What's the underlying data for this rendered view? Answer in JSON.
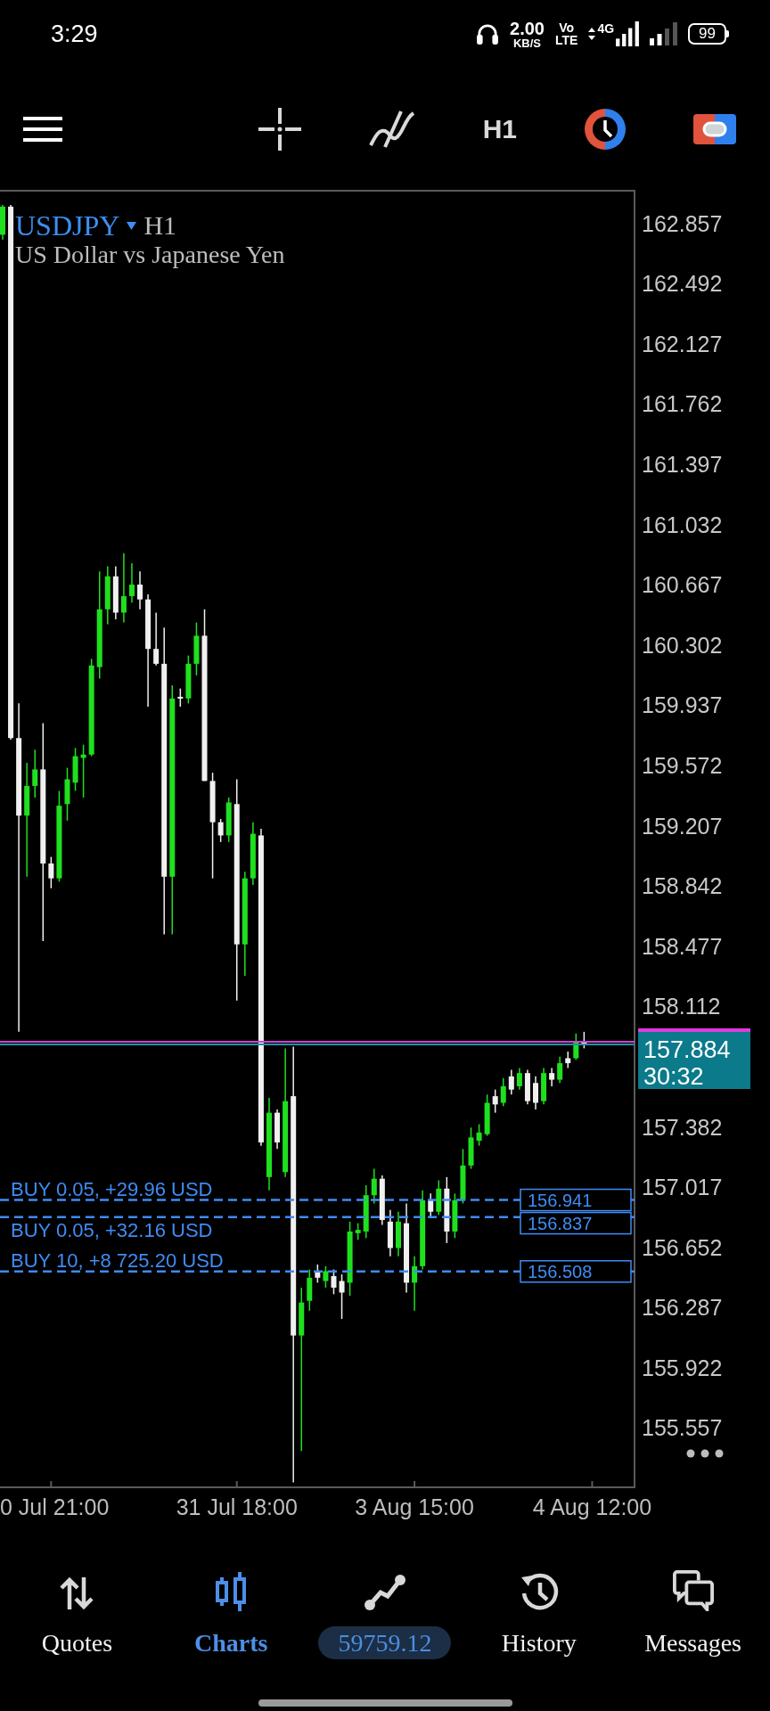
{
  "status_bar": {
    "time": "3:29",
    "speed": "2.00",
    "speed_unit": "KB/S",
    "volte_top": "Vo",
    "volte_bottom": "LTE",
    "network": "4G",
    "battery": "99"
  },
  "toolbar": {
    "timeframe": "H1"
  },
  "chart": {
    "symbol": "USDJPY",
    "period": "H1",
    "description": "US Dollar vs Japanese Yen",
    "current_price": "157.884",
    "bar_countdown": "30:32",
    "orders": [
      {
        "label": "BUY 0.05, +29.96 USD",
        "price": "156.941"
      },
      {
        "label": "BUY 0.05, +32.16 USD",
        "price": "156.837"
      },
      {
        "label": "BUY 10, +8 725.20 USD",
        "price": "156.508"
      }
    ],
    "chart_data": {
      "type": "candlestick",
      "categories": [
        null,
        null,
        null,
        null,
        null,
        null,
        "0 Jul 21:00",
        null,
        null,
        null,
        null,
        null,
        null,
        null,
        null,
        null,
        null,
        null,
        null,
        null,
        null,
        null,
        null,
        null,
        null,
        null,
        null,
        null,
        null,
        "31 Jul 18:00",
        null,
        null,
        null,
        null,
        null,
        null,
        null,
        null,
        null,
        null,
        null,
        null,
        null,
        null,
        null,
        null,
        null,
        null,
        null,
        null,
        null,
        "3 Aug 15:00",
        null,
        null,
        null,
        null,
        null,
        null,
        null,
        null,
        null,
        null,
        null,
        null,
        null,
        null,
        null,
        null,
        null,
        null,
        null,
        null,
        null,
        "4 Aug 12:00"
      ],
      "ohlc": [
        [
          162.79,
          162.97,
          162.76,
          162.96
        ],
        [
          162.96,
          162.97,
          159.73,
          159.74
        ],
        [
          159.74,
          159.95,
          157.96,
          159.27
        ],
        [
          159.27,
          159.59,
          158.9,
          159.45
        ],
        [
          159.45,
          159.67,
          159.38,
          159.55
        ],
        [
          159.55,
          159.83,
          158.51,
          158.98
        ],
        [
          158.98,
          159.02,
          158.83,
          158.89
        ],
        [
          158.89,
          159.42,
          158.87,
          159.33
        ],
        [
          159.34,
          159.56,
          159.24,
          159.49
        ],
        [
          159.47,
          159.68,
          159.42,
          159.63
        ],
        [
          159.62,
          159.7,
          159.38,
          159.64
        ],
        [
          159.64,
          160.22,
          159.63,
          160.18
        ],
        [
          160.17,
          160.75,
          160.1,
          160.52
        ],
        [
          160.52,
          160.78,
          160.43,
          160.72
        ],
        [
          160.72,
          160.78,
          160.46,
          160.5
        ],
        [
          160.5,
          160.86,
          160.44,
          160.6
        ],
        [
          160.6,
          160.8,
          160.56,
          160.67
        ],
        [
          160.67,
          160.75,
          160.52,
          160.58
        ],
        [
          160.58,
          160.61,
          159.93,
          160.28
        ],
        [
          160.28,
          160.5,
          160.18,
          160.19
        ],
        [
          160.19,
          160.41,
          158.55,
          158.9
        ],
        [
          158.9,
          160.06,
          158.55,
          159.98
        ],
        [
          159.99,
          160.04,
          159.93,
          159.98
        ],
        [
          159.98,
          160.24,
          159.95,
          160.19
        ],
        [
          160.19,
          160.44,
          160.12,
          160.36
        ],
        [
          160.36,
          160.52,
          159.48,
          159.48
        ],
        [
          159.48,
          159.53,
          158.89,
          159.23
        ],
        [
          159.23,
          159.25,
          159.11,
          159.15
        ],
        [
          159.15,
          159.38,
          159.11,
          159.35
        ],
        [
          159.34,
          159.49,
          158.15,
          158.49
        ],
        [
          158.49,
          158.93,
          158.3,
          158.89
        ],
        [
          158.89,
          159.23,
          158.85,
          159.16
        ],
        [
          159.15,
          159.19,
          157.27,
          157.29
        ],
        [
          157.08,
          157.56,
          157.0,
          157.47
        ],
        [
          157.47,
          157.49,
          157.25,
          157.29
        ],
        [
          157.11,
          157.86,
          157.08,
          157.54
        ],
        [
          157.57,
          157.87,
          155.23,
          156.12
        ],
        [
          156.12,
          156.41,
          155.42,
          156.32
        ],
        [
          156.33,
          156.52,
          156.27,
          156.47
        ],
        [
          156.51,
          156.55,
          156.44,
          156.47
        ],
        [
          156.45,
          156.54,
          156.41,
          156.51
        ],
        [
          156.48,
          156.52,
          156.37,
          156.41
        ],
        [
          156.45,
          156.49,
          156.22,
          156.38
        ],
        [
          156.44,
          156.81,
          156.36,
          156.75
        ],
        [
          156.74,
          156.8,
          156.7,
          156.76
        ],
        [
          156.75,
          157.03,
          156.71,
          156.97
        ],
        [
          156.97,
          157.13,
          156.92,
          157.07
        ],
        [
          157.07,
          157.09,
          156.79,
          156.82
        ],
        [
          156.81,
          156.88,
          156.6,
          156.65
        ],
        [
          156.65,
          156.87,
          156.6,
          156.81
        ],
        [
          156.8,
          156.92,
          156.38,
          156.44
        ],
        [
          156.44,
          156.6,
          156.27,
          156.54
        ],
        [
          156.54,
          157.0,
          156.52,
          156.94
        ],
        [
          156.94,
          156.98,
          156.84,
          156.87
        ],
        [
          156.87,
          157.06,
          156.85,
          157.01
        ],
        [
          157.01,
          157.08,
          156.68,
          156.75
        ],
        [
          156.75,
          156.98,
          156.71,
          156.94
        ],
        [
          156.94,
          157.25,
          156.92,
          157.15
        ],
        [
          157.15,
          157.38,
          157.13,
          157.32
        ],
        [
          157.3,
          157.4,
          157.27,
          157.35
        ],
        [
          157.34,
          157.58,
          157.33,
          157.53
        ],
        [
          157.57,
          157.61,
          157.47,
          157.52
        ],
        [
          157.53,
          157.68,
          157.51,
          157.63
        ],
        [
          157.69,
          157.73,
          157.58,
          157.61
        ],
        [
          157.63,
          157.74,
          157.61,
          157.71
        ],
        [
          157.71,
          157.73,
          157.52,
          157.54
        ],
        [
          157.65,
          157.69,
          157.49,
          157.53
        ],
        [
          157.54,
          157.74,
          157.52,
          157.71
        ],
        [
          157.71,
          157.74,
          157.63,
          157.67
        ],
        [
          157.67,
          157.81,
          157.65,
          157.77
        ],
        [
          157.8,
          157.84,
          157.74,
          157.77
        ],
        [
          157.8,
          157.95,
          157.79,
          157.9
        ],
        [
          157.9,
          157.96,
          157.86,
          157.88
        ],
        null
      ],
      "ylim": [
        155.2,
        163.062
      ],
      "yticks": [
        162.857,
        162.492,
        162.127,
        161.762,
        161.397,
        161.032,
        160.667,
        160.302,
        159.937,
        159.572,
        159.207,
        158.842,
        158.477,
        158.112,
        157.382,
        157.017,
        156.652,
        156.287,
        155.922,
        155.557
      ],
      "ref_lines": [
        {
          "axis": "y",
          "value": 157.9,
          "color": "#d83cd8"
        },
        {
          "axis": "y",
          "value": 157.884,
          "color": "#1b93a5"
        },
        {
          "axis": "y",
          "value": 156.941,
          "color": "#3f8cf5"
        },
        {
          "axis": "y",
          "value": 156.837,
          "color": "#3f8cf5"
        },
        {
          "axis": "y",
          "value": 156.508,
          "color": "#3f8cf5"
        }
      ]
    }
  },
  "bottom_nav": {
    "items": [
      {
        "kind": "quotes",
        "label": "Quotes",
        "selected": false
      },
      {
        "kind": "charts",
        "label": "Charts",
        "selected": true
      },
      {
        "kind": "balance",
        "label": "59759.12",
        "selected": false
      },
      {
        "kind": "history",
        "label": "History",
        "selected": false
      },
      {
        "kind": "messages",
        "label": "Messages",
        "selected": false
      }
    ]
  }
}
